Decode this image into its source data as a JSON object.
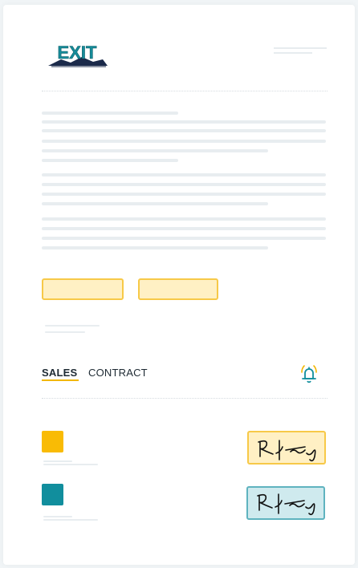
{
  "brand": {
    "logo_text": "EXIT",
    "colors": {
      "logo_teal": "#168c9a",
      "logo_navy": "#1b2a4a"
    }
  },
  "tabs": [
    {
      "label": "SALES",
      "active": true
    },
    {
      "label": "CONTRACT",
      "active": false
    }
  ],
  "icons": {
    "notification": "bell-ringing-icon"
  },
  "signers": [
    {
      "color": "#f9bb05",
      "signature_style": "yellow-box"
    },
    {
      "color": "#118e9d",
      "signature_style": "teal-box"
    }
  ],
  "colors": {
    "accent_yellow": "#f7c948",
    "accent_teal": "#118e9d",
    "field_fill": "#fff0c4"
  }
}
